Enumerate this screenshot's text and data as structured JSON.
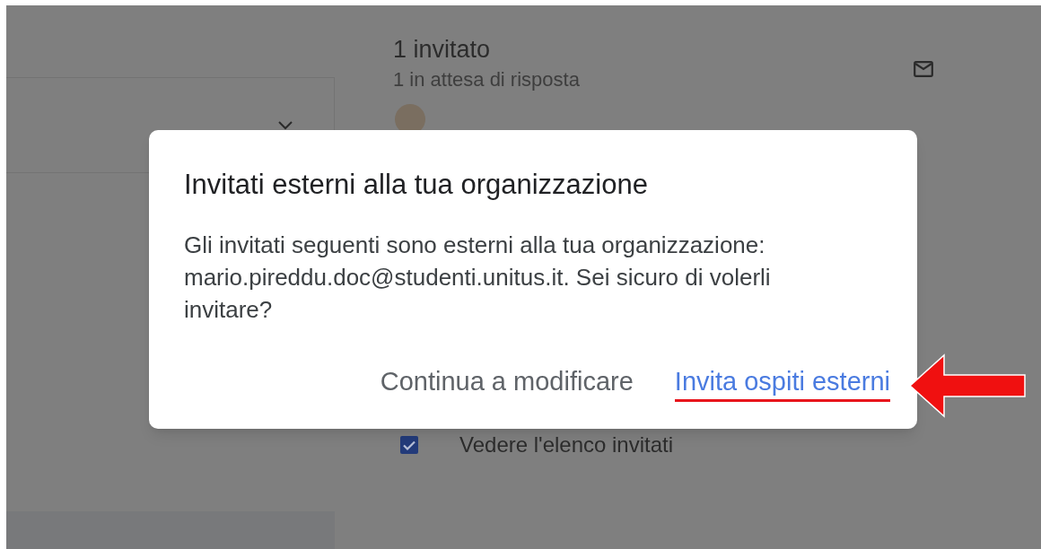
{
  "background": {
    "guests_count": "1 invitato",
    "guests_status": "1 in attesa di risposta",
    "permissions": [
      {
        "label": "Vedere l'elenco invitati",
        "checked": true
      }
    ]
  },
  "dialog": {
    "title": "Invitati esterni alla tua organizzazione",
    "message": "Gli invitati seguenti sono esterni alla tua organizzazione: mario.pireddu.doc@studenti.unitus.it. Sei sicuro di volerli invitare?",
    "buttons": [
      {
        "label": "Continua a modificare",
        "kind": "secondary",
        "highlighted": false
      },
      {
        "label": "Invita ospiti esterni",
        "kind": "primary",
        "highlighted": true
      }
    ]
  }
}
